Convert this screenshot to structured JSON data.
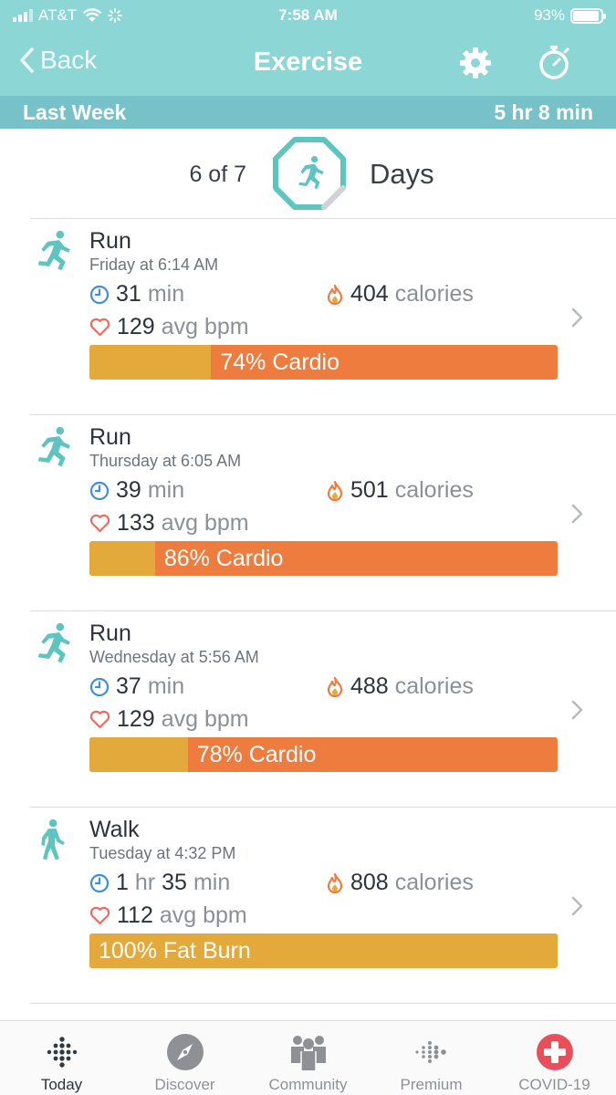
{
  "status": {
    "carrier": "AT&T",
    "time": "7:58 AM",
    "battery": "93%"
  },
  "nav": {
    "back_label": "Back",
    "title": "Exercise"
  },
  "week": {
    "label": "Last Week",
    "total": "5 hr 8 min"
  },
  "summary": {
    "count": "6 of 7",
    "days": "Days"
  },
  "colors": {
    "header": "#8dd6d6",
    "subheader": "#77c1c8",
    "teal": "#5ec4c0",
    "cardio": "#ef7c3f",
    "fat_burn": "#e3a93a",
    "covid": "#e94f5b"
  },
  "exercises": [
    {
      "icon": "run-icon",
      "name": "Run",
      "when": "Friday at 6:14 AM",
      "duration_num": "31",
      "duration_unit": "min",
      "calories_num": "404",
      "calories_unit": "calories",
      "bpm_num": "129",
      "bpm_unit": "avg bpm",
      "zone_label": "74% Cardio",
      "fat_burn_fraction": 0.26
    },
    {
      "icon": "run-icon",
      "name": "Run",
      "when": "Thursday at 6:05 AM",
      "duration_num": "39",
      "duration_unit": "min",
      "calories_num": "501",
      "calories_unit": "calories",
      "bpm_num": "133",
      "bpm_unit": "avg bpm",
      "zone_label": "86% Cardio",
      "fat_burn_fraction": 0.14
    },
    {
      "icon": "run-icon",
      "name": "Run",
      "when": "Wednesday at 5:56 AM",
      "duration_num": "37",
      "duration_unit": "min",
      "calories_num": "488",
      "calories_unit": "calories",
      "bpm_num": "129",
      "bpm_unit": "avg bpm",
      "zone_label": "78% Cardio",
      "fat_burn_fraction": 0.21
    },
    {
      "icon": "walk-icon",
      "name": "Walk",
      "when": "Tuesday at 4:32 PM",
      "duration_num": "1",
      "duration_hr": "hr",
      "duration_num2": "35",
      "duration_unit": "min",
      "calories_num": "808",
      "calories_unit": "calories",
      "bpm_num": "112",
      "bpm_unit": "avg bpm",
      "zone_label": "100% Fat Burn",
      "fat_burn_fraction": 1.0
    }
  ],
  "tabs": [
    {
      "label": "Today",
      "icon": "fitbit-dots-icon",
      "active": true
    },
    {
      "label": "Discover",
      "icon": "compass-icon",
      "active": false
    },
    {
      "label": "Community",
      "icon": "community-icon",
      "active": false
    },
    {
      "label": "Premium",
      "icon": "premium-dots-icon",
      "active": false
    },
    {
      "label": "COVID-19",
      "icon": "red-cross-icon",
      "active": false
    }
  ]
}
